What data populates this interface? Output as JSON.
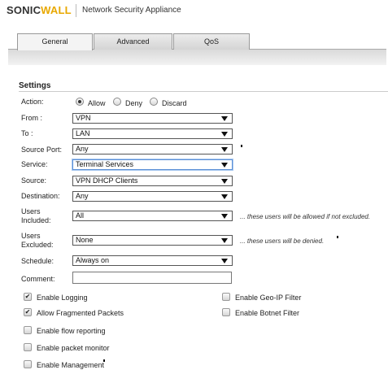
{
  "header": {
    "brand_prefix": "SONIC",
    "brand_suffix": "WALL",
    "product": "Network Security Appliance"
  },
  "tabs": [
    {
      "label": "General",
      "active": true
    },
    {
      "label": "Advanced",
      "active": false
    },
    {
      "label": "QoS",
      "active": false
    }
  ],
  "settings": {
    "title": "Settings",
    "action": {
      "label": "Action:",
      "options": [
        "Allow",
        "Deny",
        "Discard"
      ],
      "selected": "Allow"
    },
    "from": {
      "label": "From :",
      "value": "VPN"
    },
    "to": {
      "label": "To :",
      "value": "LAN"
    },
    "source_port": {
      "label": "Source Port:",
      "value": "Any"
    },
    "service": {
      "label": "Service:",
      "value": "Terminal Services"
    },
    "source": {
      "label": "Source:",
      "value": "VPN DHCP Clients"
    },
    "destination": {
      "label": "Destination:",
      "value": "Any"
    },
    "users_included": {
      "label_line1": "Users",
      "label_line2": "Included:",
      "value": "All",
      "hint": "... these users will be allowed if not excluded."
    },
    "users_excluded": {
      "label_line1": "Users",
      "label_line2": "Excluded:",
      "value": "None",
      "hint": "... these users will be denied."
    },
    "schedule": {
      "label": "Schedule:",
      "value": "Always on"
    },
    "comment": {
      "label": "Comment:",
      "value": ""
    }
  },
  "checkboxes": [
    {
      "label": "Enable Logging",
      "checked": true
    },
    {
      "label": "Allow Fragmented Packets",
      "checked": true
    },
    {
      "label": "Enable flow reporting",
      "checked": false
    },
    {
      "label": "Enable packet monitor",
      "checked": false
    },
    {
      "label": "Enable Management",
      "checked": false
    },
    {
      "label": "Enable Geo-IP Filter",
      "checked": false
    },
    {
      "label": "Enable Botnet Filter",
      "checked": false
    }
  ],
  "colors": {
    "brand_accent": "#e8a800",
    "focus_border": "#5b8fd6"
  }
}
